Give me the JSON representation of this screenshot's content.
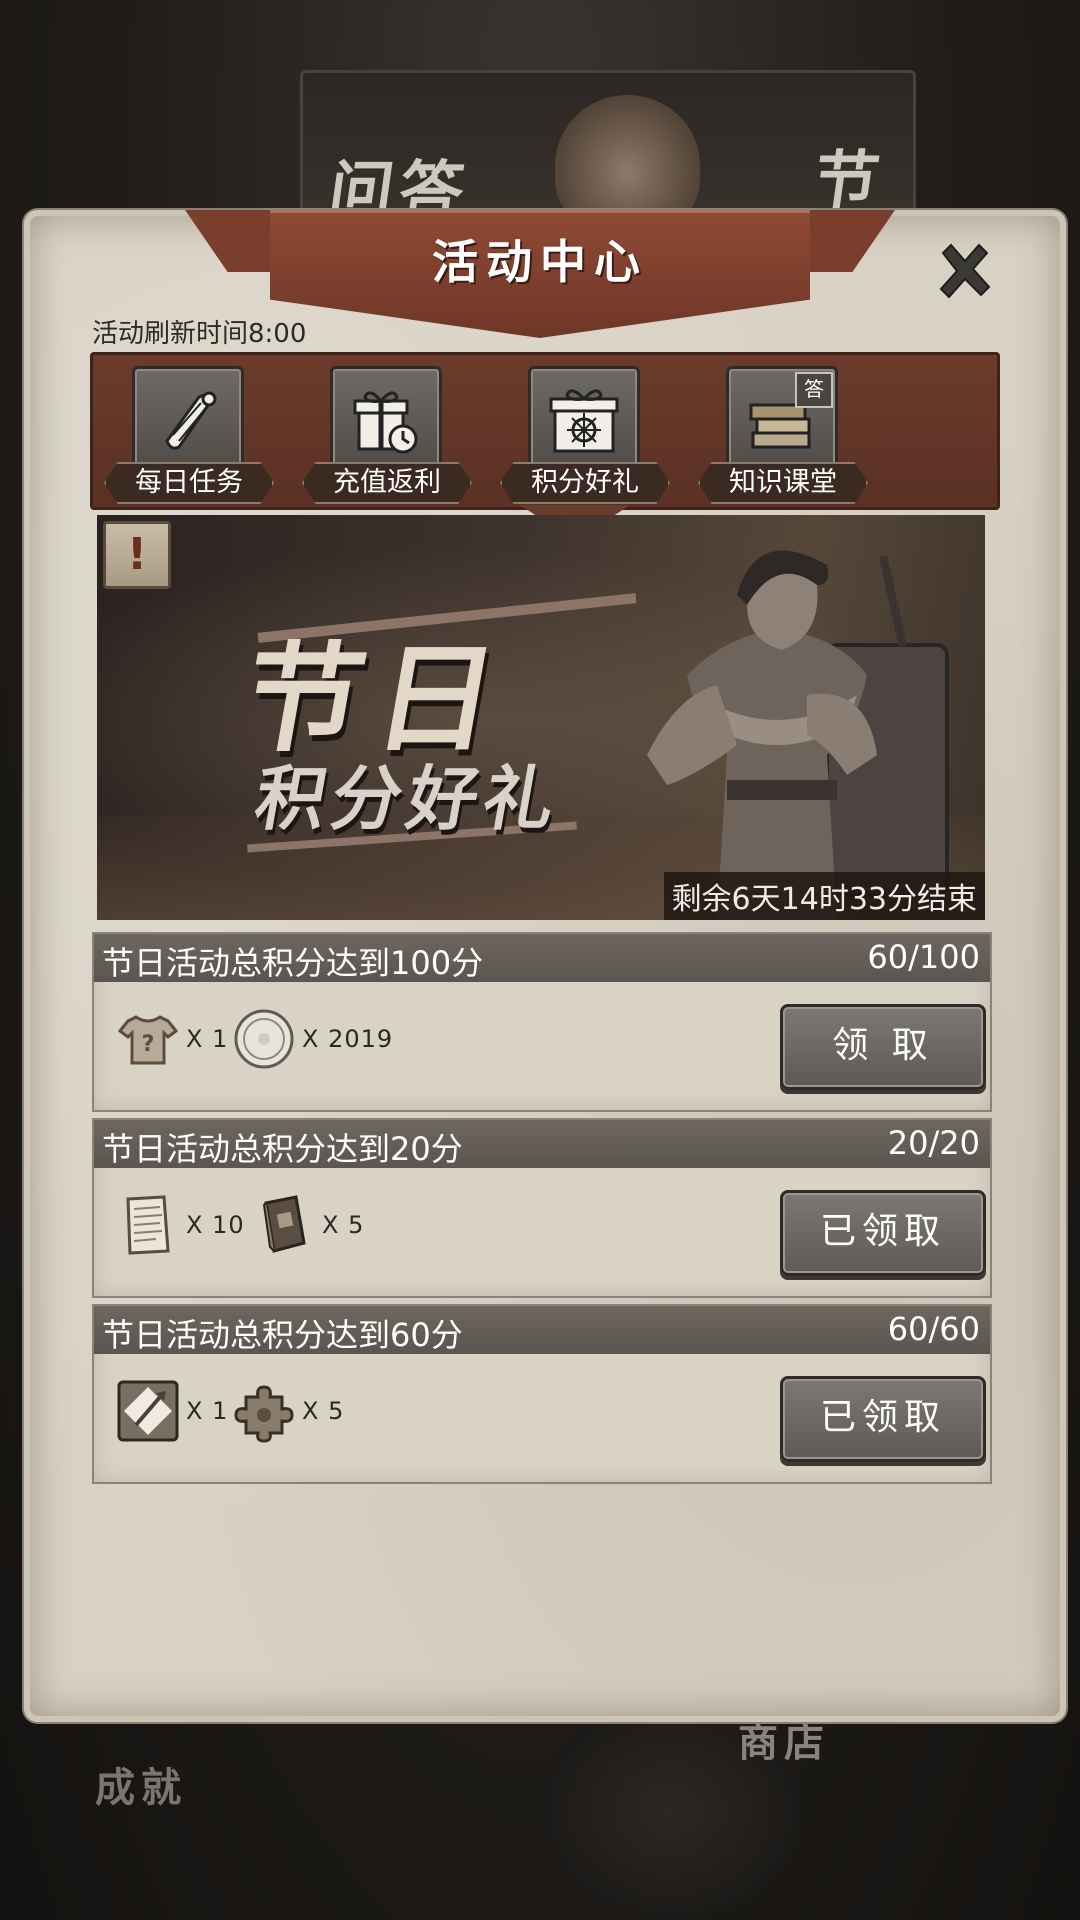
{
  "background": {
    "top_left_text": "问答",
    "top_right_text": "节",
    "bottom_left_text": "成就",
    "bottom_right_text": "商店"
  },
  "panel": {
    "title": "活动中心",
    "refresh_time": "活动刷新时间8:00"
  },
  "tabs": [
    {
      "label": "每日任务",
      "icon": "scroll-icon"
    },
    {
      "label": "充值返利",
      "icon": "gift-clock-icon"
    },
    {
      "label": "积分好礼",
      "icon": "gift-box-icon",
      "active": true
    },
    {
      "label": "知识课堂",
      "icon": "books-icon",
      "badge": "答"
    }
  ],
  "banner": {
    "title": "节日",
    "subtitle": "积分好礼",
    "countdown": "剩余6天14时33分结束",
    "alert": "!"
  },
  "tasks": [
    {
      "title": "节日活动总积分达到100分",
      "progress": "60/100",
      "rewards": [
        {
          "icon": "mystery-shirt-icon",
          "qty": "X 1"
        },
        {
          "icon": "coin-icon",
          "qty": "X 2019"
        }
      ],
      "button": "领 取"
    },
    {
      "title": "节日活动总积分达到20分",
      "progress": "20/20",
      "rewards": [
        {
          "icon": "paper-icon",
          "qty": "X 10"
        },
        {
          "icon": "book-icon",
          "qty": "X 5"
        }
      ],
      "button": "已领取"
    },
    {
      "title": "节日活动总积分达到60分",
      "progress": "60/60",
      "rewards": [
        {
          "icon": "spear-badge-icon",
          "qty": "X 1"
        },
        {
          "icon": "puzzle-piece-icon",
          "qty": "X 5"
        }
      ],
      "button": "已领取"
    }
  ],
  "colors": {
    "accent": "#7a3e2c",
    "panel_bg": "#d8d2c4",
    "header_bar": "#5b554f"
  }
}
